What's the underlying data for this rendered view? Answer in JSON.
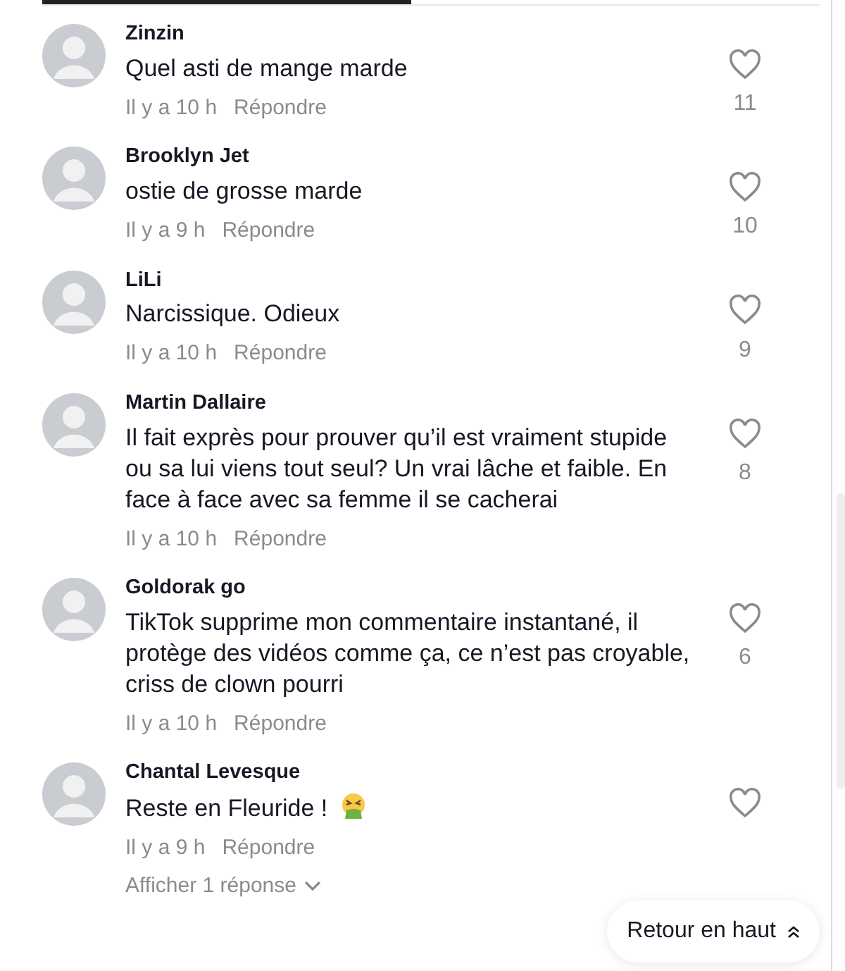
{
  "comments": [
    {
      "author": "Zinzin",
      "text": "Quel asti de mange marde",
      "time": "Il y a 10 h",
      "reply": "Répondre",
      "likes": "11",
      "liked": false
    },
    {
      "author": "Brooklyn Jet",
      "text": "ostie de grosse marde",
      "time": "Il y a 9 h",
      "reply": "Répondre",
      "likes": "10",
      "liked": false
    },
    {
      "author": "LiLi",
      "text": "Narcissique. Odieux",
      "time": "Il y a 10 h",
      "reply": "Répondre",
      "likes": "9",
      "liked": false
    },
    {
      "author": "Martin Dallaire",
      "text": "Il fait exprès pour prouver qu’il est vraiment stupide ou sa lui viens tout seul? Un vrai lâche et faible. En face à face avec sa femme il se cacherai",
      "time": "Il y a 10 h",
      "reply": "Répondre",
      "likes": "8",
      "liked": false
    },
    {
      "author": "Goldorak go",
      "text": "TikTok supprime mon commentaire instantané, il protège des vidéos comme ça, ce n’est pas croyable, criss de clown pourri",
      "time": "Il y a 10 h",
      "reply": "Répondre",
      "likes": "6",
      "liked": false
    },
    {
      "author": "Chantal Levesque",
      "text": "Reste en Fleuride !",
      "emoji": true,
      "time": "Il y a 9 h",
      "reply": "Répondre",
      "liked": false,
      "replies_link": "Afficher 1 réponse"
    }
  ],
  "back_to_top": "Retour en haut"
}
